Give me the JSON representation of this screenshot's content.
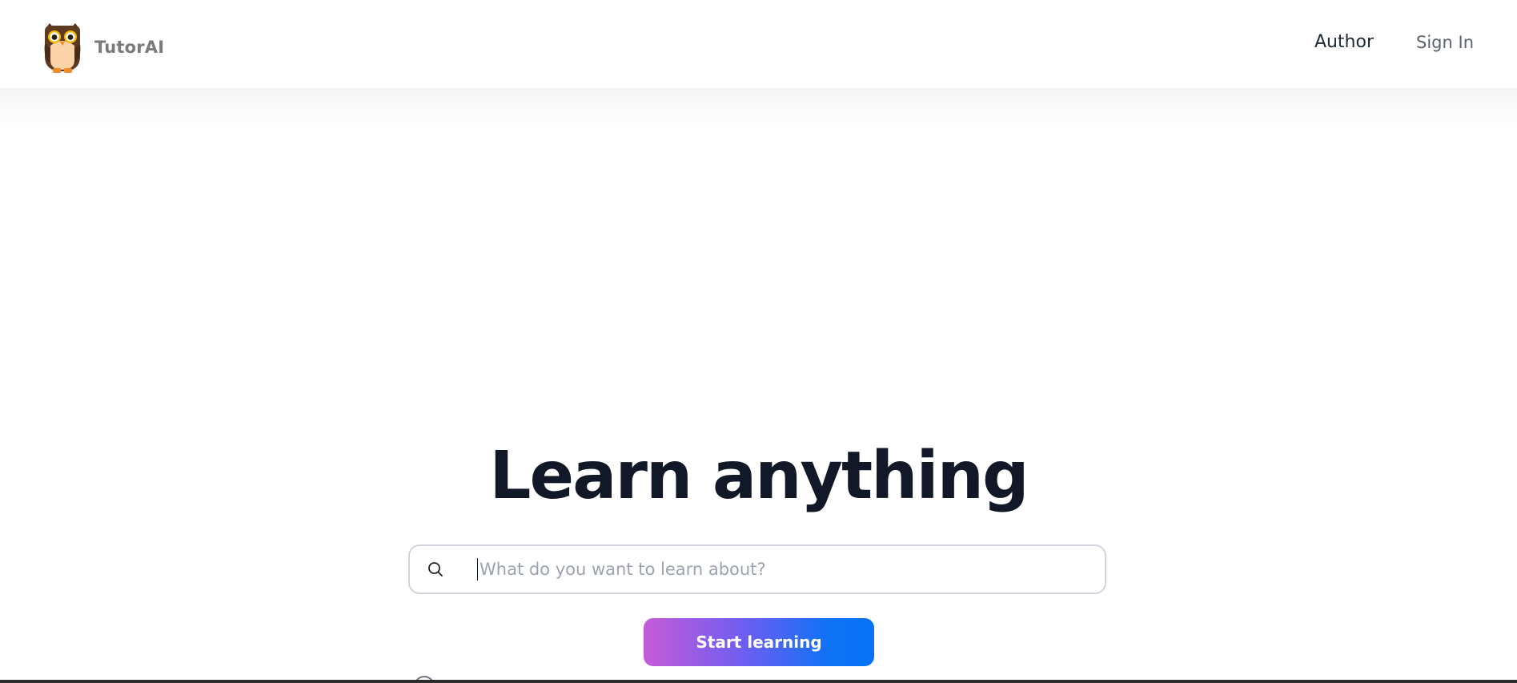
{
  "header": {
    "brand": {
      "name": "TutorAI",
      "logo_icon": "owl-icon"
    },
    "nav": {
      "author_label": "Author",
      "sign_in_label": "Sign In"
    }
  },
  "hero": {
    "title": "Learn anything",
    "search": {
      "icon": "search-icon",
      "value": "",
      "placeholder": "What do you want to learn about?"
    },
    "start_button_label": "Start learning"
  },
  "colors": {
    "title": "#111827",
    "brand_text": "#7a7a7a",
    "button_gradient_start": "#c55bd8",
    "button_gradient_end": "#0673f7",
    "owl_body": "#5d3a22",
    "owl_belly": "#fbd3a8",
    "owl_eye_ring": "#f5b800",
    "owl_feet": "#f08a24"
  }
}
